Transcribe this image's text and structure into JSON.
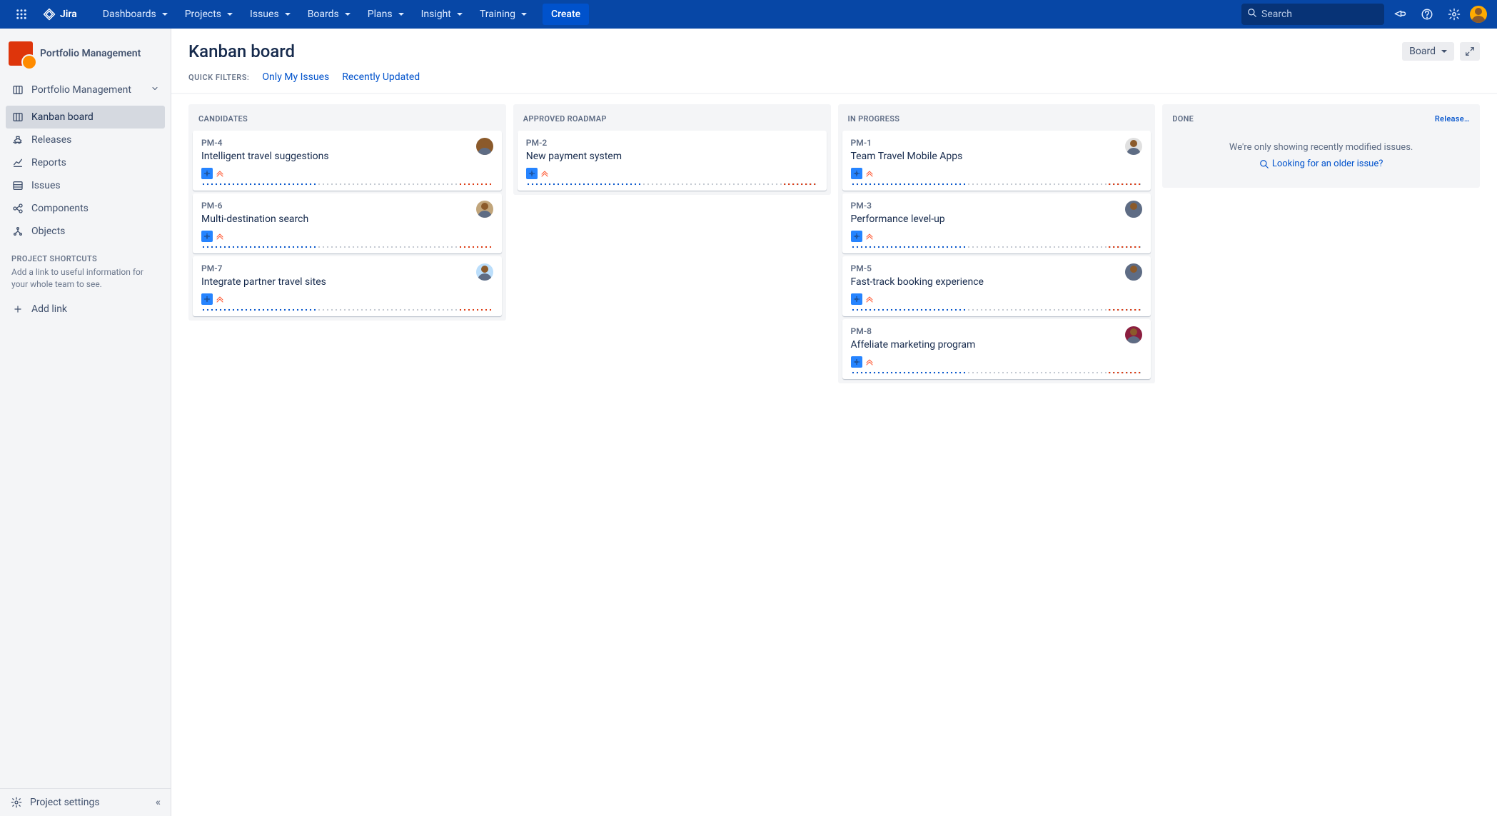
{
  "nav": {
    "product": "Jira",
    "items": [
      "Dashboards",
      "Projects",
      "Issues",
      "Boards",
      "Plans",
      "Insight",
      "Training"
    ],
    "create": "Create",
    "searchPlaceholder": "Search"
  },
  "sidebar": {
    "projectName": "Portfolio Management",
    "projectDropdown": "Portfolio Management",
    "navItems": [
      {
        "icon": "board",
        "label": "Kanban board",
        "selected": true
      },
      {
        "icon": "ship",
        "label": "Releases"
      },
      {
        "icon": "chart",
        "label": "Reports"
      },
      {
        "icon": "list",
        "label": "Issues"
      },
      {
        "icon": "component",
        "label": "Components"
      },
      {
        "icon": "object",
        "label": "Objects"
      }
    ],
    "shortcutsHeading": "PROJECT SHORTCUTS",
    "shortcutsText": "Add a link to useful information for your whole team to see.",
    "addLink": "Add link",
    "settings": "Project settings"
  },
  "board": {
    "title": "Kanban board",
    "boardBtn": "Board",
    "quickFiltersLabel": "QUICK FILTERS:",
    "filters": [
      "Only My Issues",
      "Recently Updated"
    ],
    "columns": [
      {
        "name": "CANDIDATES",
        "release": null,
        "cards": [
          {
            "key": "PM-4",
            "summary": "Intelligent travel suggestions",
            "avatarColor": "#8B5A2B"
          },
          {
            "key": "PM-6",
            "summary": "Multi-destination search",
            "avatarColor": "#C1A57B"
          },
          {
            "key": "PM-7",
            "summary": "Integrate partner travel sites",
            "avatarColor": "#BBDEFB"
          }
        ]
      },
      {
        "name": "APPROVED ROADMAP",
        "release": null,
        "cards": [
          {
            "key": "PM-2",
            "summary": "New payment system",
            "avatarColor": null
          }
        ]
      },
      {
        "name": "IN PROGRESS",
        "release": null,
        "cards": [
          {
            "key": "PM-1",
            "summary": "Team Travel Mobile Apps",
            "avatarColor": "#E0E0E0"
          },
          {
            "key": "PM-3",
            "summary": "Performance level-up",
            "avatarColor": "#5E6C84"
          },
          {
            "key": "PM-5",
            "summary": "Fast-track booking experience",
            "avatarColor": "#5E6C84"
          },
          {
            "key": "PM-8",
            "summary": "Affeliate marketing program",
            "avatarColor": "#8B1E3F"
          }
        ]
      },
      {
        "name": "DONE",
        "release": "Release…",
        "empty": {
          "text": "We're only showing recently modified issues.",
          "link": "Looking for an older issue?"
        }
      }
    ]
  }
}
